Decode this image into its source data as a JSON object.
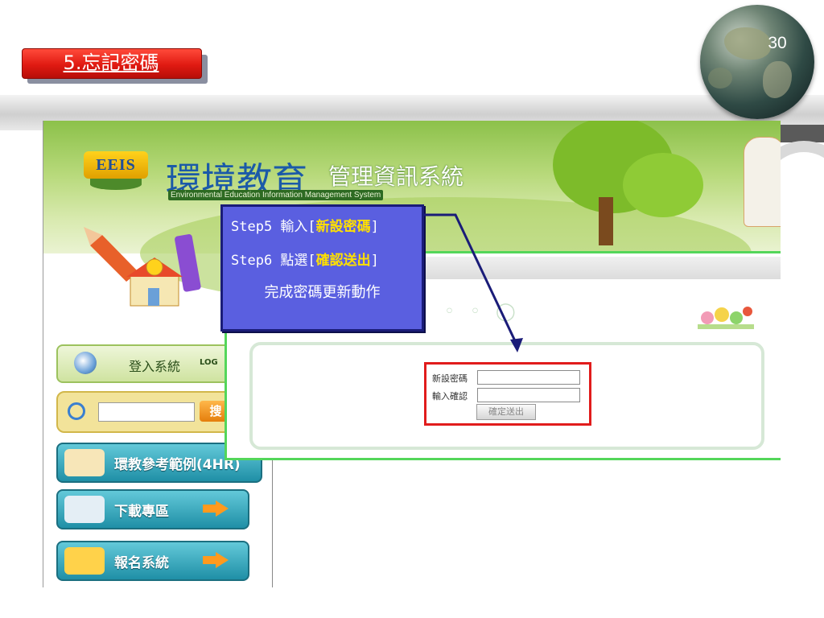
{
  "slide": {
    "title": "5.忘記密碼",
    "page_number": "30"
  },
  "site": {
    "logo_text": "EEIS",
    "title_large": "環境教育",
    "title_small": "管理資訊系統",
    "subtitle": "Environmental Education Information Management System"
  },
  "sidebar": {
    "login_label": "登入系統",
    "login_sub": "LOG",
    "search_button": "搜",
    "items": [
      {
        "label": "環教參考範例(4HR)",
        "icon": "books-icon"
      },
      {
        "label": "下載專區",
        "icon": "download-icon"
      },
      {
        "label": "報名系統",
        "icon": "folder-icon"
      }
    ]
  },
  "form": {
    "new_password_label": "新設密碼",
    "confirm_label": "輸入確認",
    "new_password_value": "",
    "confirm_value": "",
    "submit_label": "確定送出"
  },
  "callout": {
    "step5_prefix": "Step5 輸入[",
    "step5_highlight": "新設密碼",
    "step5_suffix": "]",
    "step6_prefix": "Step6 點選[",
    "step6_highlight": "確認送出",
    "step6_suffix": "]",
    "finish_text": "完成密碼更新動作"
  },
  "colors": {
    "title_tag": "#e01a12",
    "callout_bg": "#5a5fe0",
    "highlight_text": "#ffe000",
    "panel_border": "#53d65a",
    "red_box": "#e11c1c",
    "arrow": "#1a1c78"
  }
}
